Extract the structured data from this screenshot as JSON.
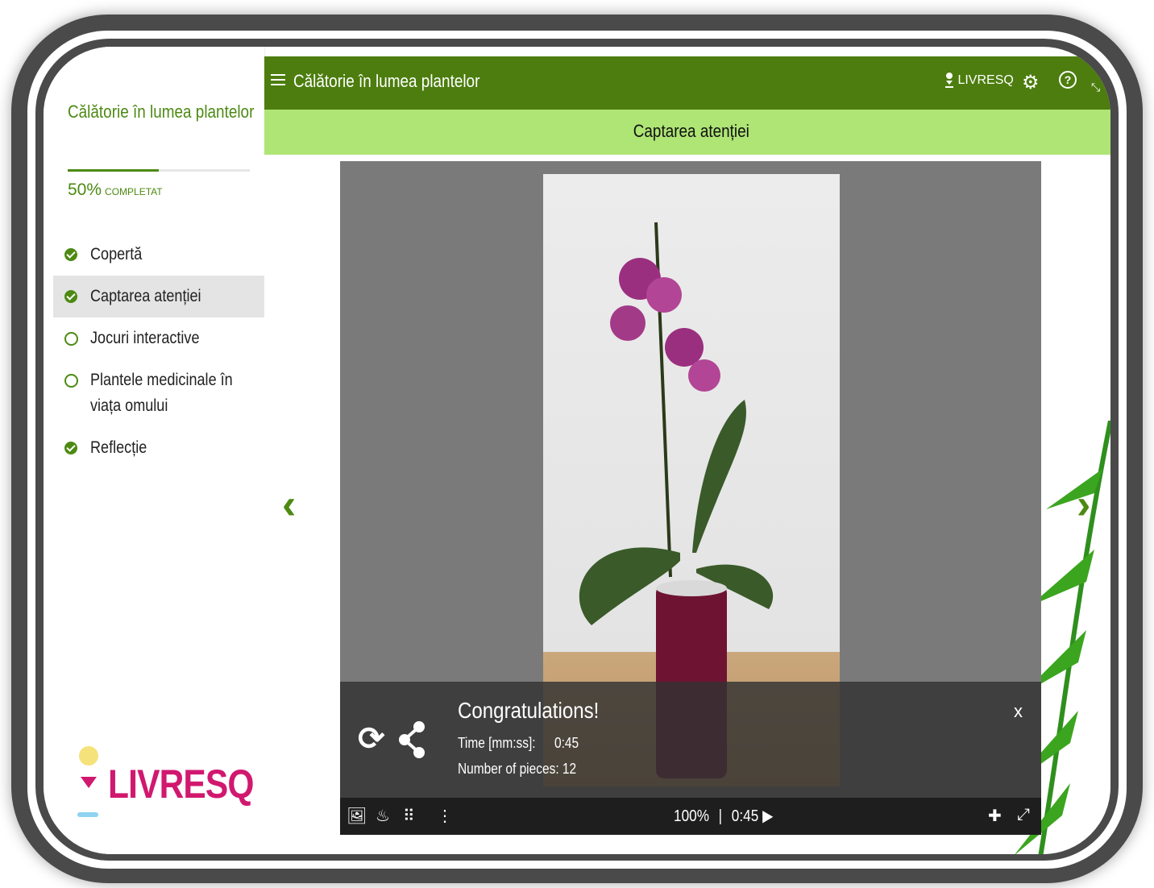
{
  "app": {
    "title": "Călătorie în lumea plantelor",
    "brand": "LIVRESQ",
    "accent": "#4c8a13",
    "topbar_color": "#4c7d0e",
    "subbar_color": "#aee575"
  },
  "sidebar": {
    "title": "Călătorie în lumea plantelor",
    "progress_percent": "50%",
    "progress_label": "COMPLETAT",
    "progress_value": 0.5,
    "items": [
      {
        "label": "Copertă",
        "status": "done"
      },
      {
        "label": "Captarea atenției",
        "status": "done"
      },
      {
        "label": "Jocuri interactive",
        "status": "todo"
      },
      {
        "label": "Plantele medicinale în viața omului",
        "status": "todo"
      },
      {
        "label": "Reflecție",
        "status": "done"
      }
    ],
    "logo_text": "LIVRESQ"
  },
  "header": {
    "title": "Călătorie în lumea plantelor",
    "logo_text": "LIVRESQ",
    "icons": [
      "menu-icon",
      "gear-icon",
      "help-icon",
      "expand-icon"
    ]
  },
  "section": {
    "title": "Captarea atenției"
  },
  "puzzle": {
    "result": {
      "title": "Congratulations!",
      "time_label": "Time [mm:ss]:",
      "time_value": "0:45",
      "pieces_label": "Number of pieces: 12",
      "close": "x"
    },
    "toolbar": {
      "zoom": "100%",
      "separator": "|",
      "timer": "0:45",
      "icons": [
        "image-icon",
        "ghost-icon",
        "grid-icon",
        "more-icon",
        "puzzle-icon",
        "fullscreen-icon"
      ]
    }
  }
}
